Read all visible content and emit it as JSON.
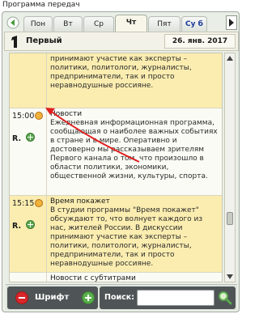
{
  "app": {
    "title": "Программа передач"
  },
  "tabs": [
    {
      "label": "Пон",
      "active": false
    },
    {
      "label": "Вт",
      "active": false
    },
    {
      "label": "Ср",
      "active": false
    },
    {
      "label": "Чт",
      "active": true
    },
    {
      "label": "Пят",
      "active": false
    },
    {
      "label": "Су б",
      "active": false
    }
  ],
  "channel": {
    "name": "Первый",
    "logo_digit": "1",
    "date": "26. янв. 2017"
  },
  "schedule": {
    "rows": [
      {
        "time": "",
        "title": "",
        "description": "принимают участие как эксперты – политики, политологи, журналисты, предприниматели, так и просто неравнодушные россияне.",
        "highlight": true
      },
      {
        "time": "15:00",
        "rating": "R.",
        "title": "Новости",
        "description": "Ежедневная информационная программа, сообщающая о наиболее важных событиях в стране и в мире. Оперативно и достоверно мы рассказываем зрителям Первого канала о том, что произошло в области политики, экономики, общественной жизни, культуры, спорта.",
        "highlight": false
      },
      {
        "time": "15:15",
        "rating": "R.",
        "title": "Время покажет",
        "description": "В студии программы \"Время покажет\" обсуждают то, что волнует каждого из нас, жителей России. В дискуссии принимают участие как эксперты – политики, политологи, журналисты, предприниматели, так и просто неравнодушные россияне.",
        "highlight": true
      },
      {
        "time": "",
        "title": "Новости с субтитрами",
        "description": "",
        "highlight": false
      }
    ]
  },
  "toolbar": {
    "font_label": "Шрифт",
    "font_minus": "−",
    "font_plus": "+",
    "search_label": "Поиск:",
    "search_value": ""
  },
  "colors": {
    "highlight_row": "#fbedb0",
    "annotation_arrow": "#e02020",
    "minus_button": "#d9262a",
    "plus_button": "#58b04b"
  },
  "icons": [
    "left-arrow-icon",
    "right-arrow-icon",
    "alarm-clock-icon",
    "plus-icon",
    "minus-icon",
    "search-magnifier-icon"
  ]
}
